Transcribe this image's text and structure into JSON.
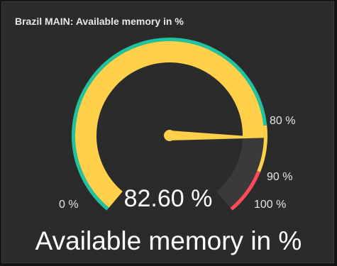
{
  "panel": {
    "title": "Brazil MAIN: Available memory in %",
    "footer_label": "Available memory in %"
  },
  "gauge": {
    "value": 82.6,
    "value_text": "82.60 %",
    "min": 0,
    "max": 100,
    "colors": {
      "value_fill": "#ffd04a",
      "empty_track": "#3a3a3a",
      "band_green": "#1fc2a1",
      "band_yellow": "#ffd04a",
      "band_red": "#ff4a5a",
      "needle": "#ffd04a"
    },
    "thresholds": [
      {
        "from": 0,
        "to": 80,
        "color": "#1fc2a1"
      },
      {
        "from": 80,
        "to": 90,
        "color": "#ffd04a"
      },
      {
        "from": 90,
        "to": 100,
        "color": "#ff4a5a"
      }
    ],
    "tick_labels": {
      "min": "0 %",
      "t80": "80 %",
      "t90": "90 %",
      "max": "100 %"
    }
  }
}
